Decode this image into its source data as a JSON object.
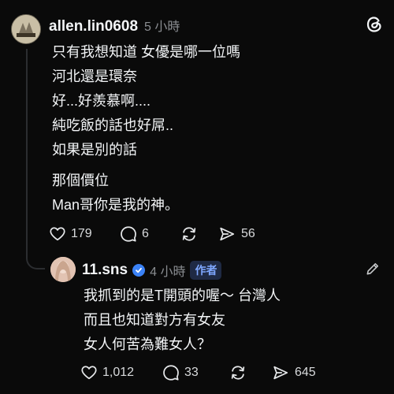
{
  "comment": {
    "username": "allen.lin0608",
    "time": "5 小時",
    "lines": [
      "只有我想知道 女優是哪一位嗎",
      "河北還是環奈",
      "好...好羨慕啊....",
      "純吃飯的話也好屌..",
      "如果是別的話",
      "那個價位",
      "Man哥你是我的神。"
    ],
    "likes": "179",
    "replies": "6",
    "shares": "56"
  },
  "reply": {
    "username": "11.sns",
    "time": "4 小時",
    "badge": "作者",
    "lines": [
      "我抓到的是T開頭的喔～ 台灣人",
      "而且也知道對方有女友",
      "女人何苦為難女人？"
    ],
    "likes": "1,012",
    "replies": "33",
    "shares": "645"
  },
  "icons": {
    "app": "threads-icon",
    "edit": "pencil-icon",
    "like": "heart-icon",
    "reply": "comment-icon",
    "repost": "repost-icon",
    "share": "send-icon"
  },
  "colors": {
    "background": "#0a0a0a",
    "badge_text": "#7fa8ff",
    "verified": "#3b82f6"
  }
}
